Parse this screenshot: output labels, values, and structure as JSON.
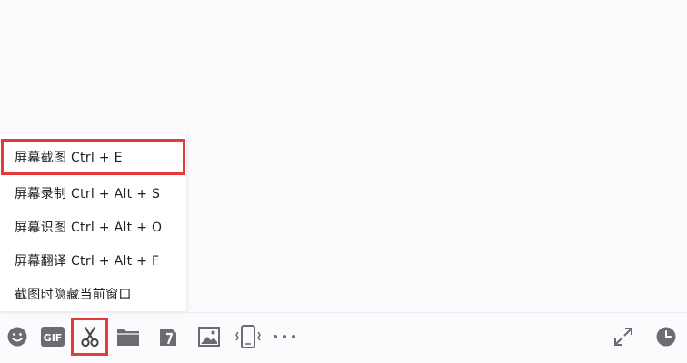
{
  "menu": {
    "items": [
      {
        "label": "屏幕截图 Ctrl + E",
        "highlighted": true
      },
      {
        "label": "屏幕录制 Ctrl + Alt + S"
      },
      {
        "label": "屏幕识图 Ctrl + Alt + O"
      },
      {
        "label": "屏幕翻译 Ctrl + Alt + F"
      },
      {
        "label": "截图时隐藏当前窗口"
      }
    ]
  },
  "toolbar": {
    "gif_label": "GIF",
    "icons": [
      "emoji-icon",
      "gif-icon",
      "scissors-icon",
      "folder-icon",
      "clipboard-icon",
      "image-icon",
      "phone-shake-icon",
      "more-icon",
      "expand-icon",
      "clock-icon"
    ]
  },
  "colors": {
    "highlight": "#e63a3a",
    "icon": "#6b6b73",
    "background": "#fbfbfd"
  }
}
